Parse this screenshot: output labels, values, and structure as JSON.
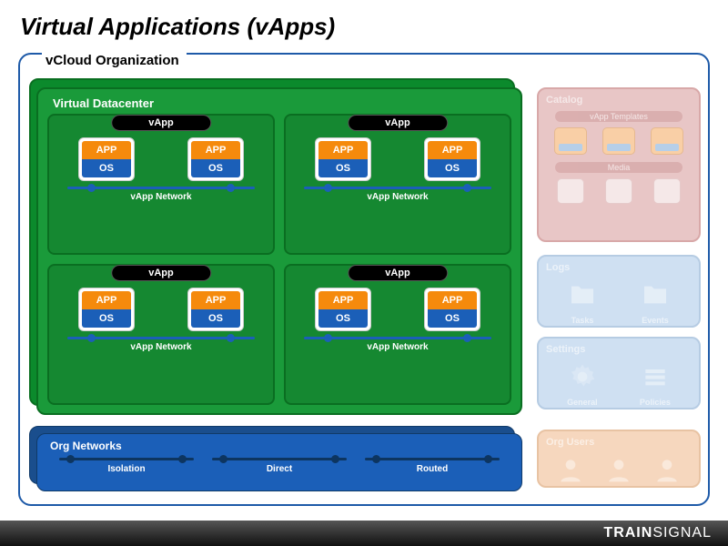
{
  "title": "Virtual Applications (vApps)",
  "org": {
    "label": "vCloud Organization"
  },
  "vdc": {
    "title": "Virtual Datacenter",
    "vapp_label": "vApp",
    "vm_app": "APP",
    "vm_os": "OS",
    "vapp_network": "vApp Network"
  },
  "orgnet": {
    "title": "Org Networks",
    "types": [
      "Isolation",
      "Direct",
      "Routed"
    ]
  },
  "catalog": {
    "title": "Catalog",
    "vapp_templates": "vApp Templates",
    "media": "Media"
  },
  "logs": {
    "title": "Logs",
    "items": [
      "Tasks",
      "Events"
    ]
  },
  "settings": {
    "title": "Settings",
    "items": [
      "General",
      "Policies"
    ]
  },
  "orgusers": {
    "title": "Org Users"
  },
  "footer": {
    "brand_a": "TRAIN",
    "brand_b": "SIGNAL"
  }
}
